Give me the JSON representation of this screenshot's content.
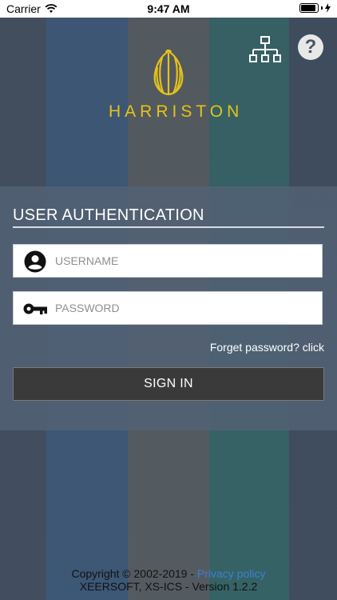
{
  "status_bar": {
    "carrier": "Carrier",
    "time": "9:47 AM"
  },
  "header": {
    "brand": "HARRISTON",
    "network_icon": "network-hierarchy-icon",
    "help_icon": "help-icon",
    "help_glyph": "?"
  },
  "login": {
    "title": "USER AUTHENTICATION",
    "username_placeholder": "USERNAME",
    "username_value": "",
    "password_placeholder": "PASSWORD",
    "password_value": "",
    "forgot_label": "Forget password? click",
    "signin_label": "SIGN IN"
  },
  "footer": {
    "copyright": "Copyright © 2002-2019 - ",
    "privacy_link": "Privacy policy",
    "version_line": "XEERSOFT, XS-ICS - Version 1.2.2"
  },
  "colors": {
    "brand_gold": "#e5c21b",
    "link_blue": "#3d7fd1",
    "button_dark": "#3a3a3a"
  }
}
